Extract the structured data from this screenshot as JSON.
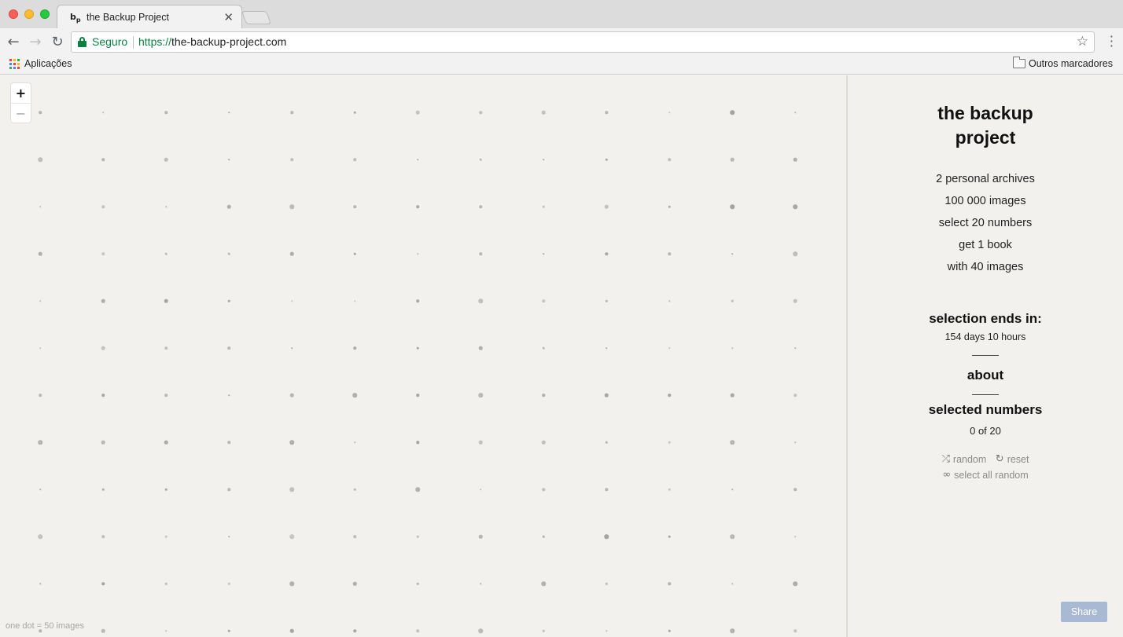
{
  "browser": {
    "tab_title": "the Backup Project",
    "favicon_text": "b",
    "favicon_sub": "p",
    "secure_label": "Seguro",
    "url_scheme": "https://",
    "url_host": "the-backup-project.com",
    "apps_label": "Aplicações",
    "other_bookmarks": "Outros marcadores",
    "icons": {
      "back": "arrow-left-icon",
      "forward": "arrow-right-icon",
      "reload": "reload-icon",
      "lock": "lock-icon",
      "bookmark": "star-icon",
      "menu": "more-vertical-icon",
      "apps": "apps-grid-icon",
      "folder": "folder-icon",
      "close_tab": "close-icon"
    }
  },
  "map": {
    "zoom_in": "+",
    "zoom_out": "−",
    "legend": "one dot = 50 images"
  },
  "sidebar": {
    "title": "the backup project",
    "facts": [
      "2 personal archives",
      "100 000 images",
      "select 20 numbers",
      "get 1 book",
      "with 40 images"
    ],
    "selection_heading": "selection ends in:",
    "selection_countdown": "154 days 10 hours",
    "about": "about",
    "selected_heading": "selected numbers",
    "selected_count": "0 of 20",
    "actions": {
      "random": "random",
      "reset": "reset",
      "select_all_random": "select all random"
    },
    "share": "Share"
  },
  "colors": {
    "background": "#f3f1ee",
    "dot": "#a5a3a0",
    "share_button": "#a9b9d3",
    "secure_green": "#0b8043"
  }
}
